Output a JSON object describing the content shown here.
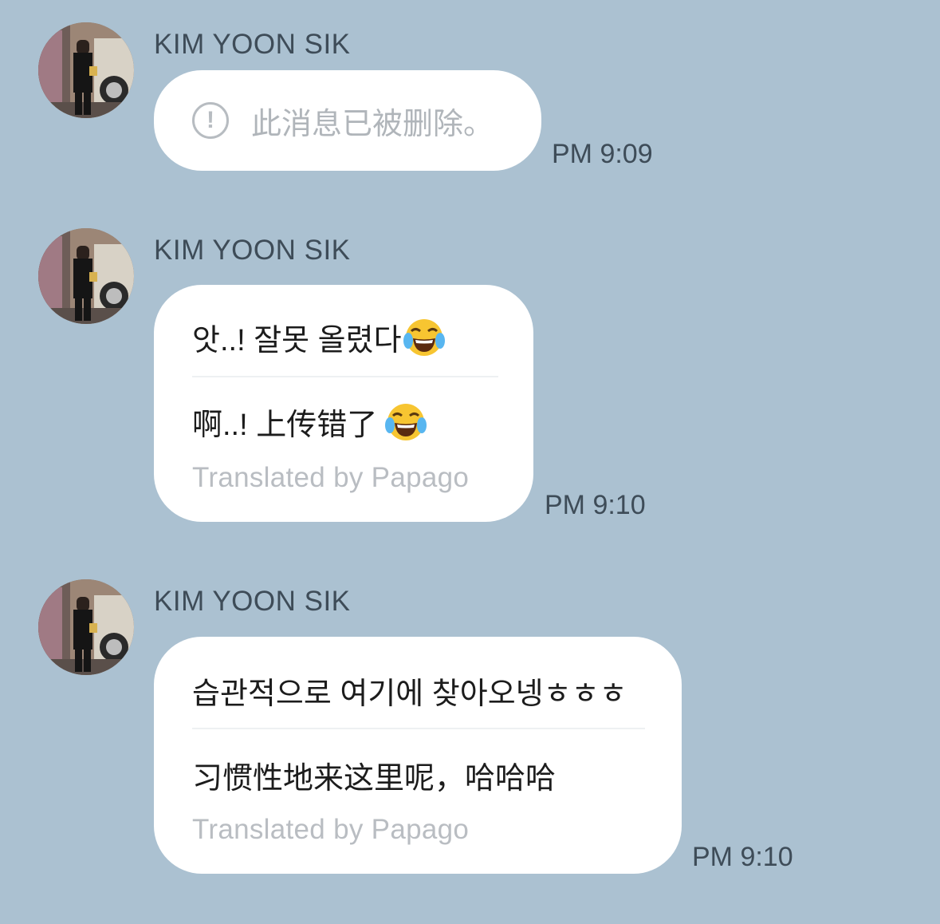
{
  "messages": [
    {
      "sender": "KIM YOON SIK",
      "deleted_text": "此消息已被删除。",
      "time": "PM 9:09"
    },
    {
      "sender": "KIM YOON SIK",
      "original": "앗..! 잘못 올렸다",
      "translation": "啊..! 上传错了",
      "translated_by": "Translated by Papago",
      "time": "PM 9:10",
      "emoji": "face-with-tears-of-joy"
    },
    {
      "sender": "KIM YOON SIK",
      "original": "습관적으로 여기에 찾아오넹ㅎㅎㅎ",
      "translation": "习惯性地来这里呢，哈哈哈",
      "translated_by": "Translated by Papago",
      "time": "PM 9:10"
    }
  ],
  "colors": {
    "background": "#abc1d1",
    "bubble": "#ffffff",
    "meta_text": "#3e4c58",
    "muted_text": "#b9bdc2"
  }
}
